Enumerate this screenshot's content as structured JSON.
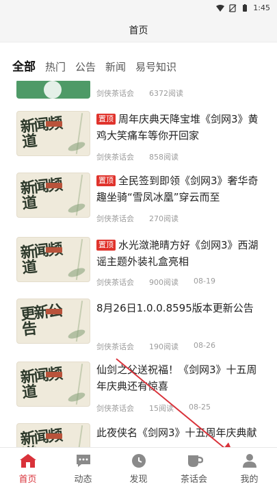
{
  "status_bar": {
    "time": "1:45"
  },
  "header": {
    "title": "首页"
  },
  "tabs": [
    {
      "label": "全部",
      "active": true
    },
    {
      "label": "热门",
      "active": false
    },
    {
      "label": "公告",
      "active": false
    },
    {
      "label": "新闻",
      "active": false
    },
    {
      "label": "易号知识",
      "active": false
    }
  ],
  "feed": {
    "partial": {
      "source": "剑侠茶话会",
      "reads": "6372阅读"
    },
    "items": [
      {
        "tag": "置顶",
        "title": "周年庆典天降宝堆《剑网3》黄鸡大笑痛车等你开回家",
        "source": "剑侠茶话会",
        "reads": "858阅读",
        "date": "",
        "thumb_text": "新闻频道"
      },
      {
        "tag": "置顶",
        "title": "全民签到即领《剑网3》奢华奇趣坐骑“雪凤冰凰”穿云而至",
        "source": "剑侠茶话会",
        "reads": "270阅读",
        "date": "",
        "thumb_text": "新闻频道"
      },
      {
        "tag": "置顶",
        "title": "水光潋滟晴方好《剑网3》西湖谣主题外装礼盒亮相",
        "source": "剑侠茶话会",
        "reads": "900阅读",
        "date": "08-19",
        "thumb_text": "新闻频道"
      },
      {
        "tag": "",
        "title": "8月26日1.0.0.8595版本更新公告",
        "source": "剑侠茶话会",
        "reads": "190阅读",
        "date": "08-26",
        "thumb_text": "更新公告"
      },
      {
        "tag": "",
        "title": "仙剑之父送祝福！《剑网3》十五周年庆典还有惊喜",
        "source": "剑侠茶话会",
        "reads": "15阅读",
        "date": "08-25",
        "thumb_text": "新闻频道"
      },
      {
        "tag": "",
        "title": "此夜侠名《剑网3》十五周年庆典献",
        "source": "",
        "reads": "",
        "date": "",
        "thumb_text": "新闻频道"
      }
    ]
  },
  "bottom_nav": [
    {
      "label": "首页",
      "icon": "home-icon",
      "active": true
    },
    {
      "label": "动态",
      "icon": "chat-icon",
      "active": false
    },
    {
      "label": "发现",
      "icon": "compass-icon",
      "active": false
    },
    {
      "label": "茶话会",
      "icon": "tea-cup-icon",
      "active": false
    },
    {
      "label": "我的",
      "icon": "person-icon",
      "active": false
    }
  ],
  "colors": {
    "accent": "#d9323a",
    "tag": "#e0332c",
    "annotation_arrow": "#d9323a"
  }
}
